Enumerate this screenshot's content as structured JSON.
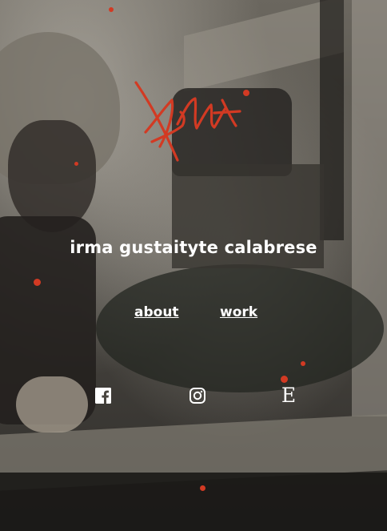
{
  "header": {
    "logo_name": "signature-logo",
    "site_title": "irma gustaityte calabrese"
  },
  "nav": {
    "about_label": "about",
    "work_label": "work"
  },
  "social": {
    "facebook_icon": "facebook-icon",
    "instagram_icon": "instagram-icon",
    "etsy_glyph": "E"
  },
  "colors": {
    "accent": "#d23a23",
    "text": "#ffffff"
  }
}
